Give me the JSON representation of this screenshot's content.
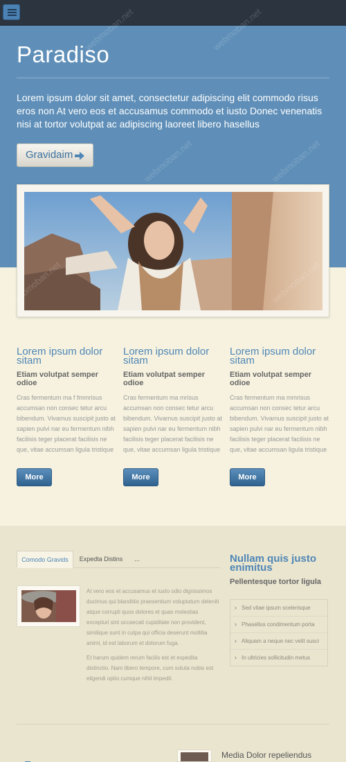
{
  "header": {
    "menu_icon": "hamburger-menu-icon"
  },
  "hero": {
    "title": "Paradiso",
    "text": "Lorem ipsum dolor sit amet, consectetur adipiscing elit commodo risus eros non At vero eos et accusamus commodo et iusto Donec venenatis nisi at tortor volutpat ac adipiscing laoreet libero hasellus",
    "button_label": "Gravidaim",
    "button_icon": "arrow-right-icon"
  },
  "features": [
    {
      "title": "Lorem ipsum dolor sitam",
      "subtitle": "Etiam volutpat semper odioe",
      "text": "Cras fermentum ma f fmmrisus accumsan non consec tetur arcu bibendum. Vivamus suscipit justo at sapien pulvi nar eu fermentum nibh facilisis teger placerat facilisis ne que, vitae accumsan ligula tristique",
      "button_label": "More"
    },
    {
      "title": "Lorem ipsum dolor sitam",
      "subtitle": "Etiam volutpat semper odioe",
      "text": "Cras fermentum ma mrisus accumsan non consec tetur arcu bibendum. Vivamus suscipit justo at sapien pulvi nar eu fermentum nibh facilisis teger placerat facilisis ne que, vitae accumsan ligula tristique",
      "button_label": "More"
    },
    {
      "title": "Lorem ipsum dolor sitam",
      "subtitle": "Etiam volutpat semper odioe",
      "text": "Cras fermentum ma mmrisus accumsan non consec tetur arcu bibendum. Vivamus suscipit justo at sapien pulvi nar eu fermentum nibh facilisis teger placerat facilisis ne que, vitae accumsan ligula tristique",
      "button_label": "More"
    }
  ],
  "tabs": {
    "items": [
      {
        "label": "Comodo Gravids"
      },
      {
        "label": "Expedta Distins"
      },
      {
        "label": "..."
      }
    ],
    "content_p1": "At vero eos et accusamus et iusto odio dignissimos ducimus qui blanditiis praesentium voluptatum deleniti atque corrupti quos dolores et quas molestias excepturi sint occaecati cupiditate non provident, similique sunt in culpa qui officia deserunt mollitia animi, id est laborum et dolorum fuga.",
    "content_p2": "Et harum quidem rerum facilis est et expedita distinctio. Nam libero tempore, cum soluta nobis est eligendi optio cumque nihil impedit."
  },
  "sidebar": {
    "title": "Nullam quis justo enimitus",
    "subtitle": "Pellentesque tortor ligula",
    "items": [
      {
        "label": "Sed vitae ipsum scelerisque"
      },
      {
        "label": "Phasellus condimentum porta"
      },
      {
        "label": "Aliquam a neque nec velit susci"
      },
      {
        "label": "In ultricies sollicitudin metus"
      }
    ]
  },
  "bottom": {
    "media_title": "Media Dolor repeliendus"
  },
  "watermark": "webmoban.net",
  "colors": {
    "topbar": "#2c3440",
    "hero": "#5f8fb8",
    "accent": "#4f86b6",
    "cream": "#f6f2df",
    "beige": "#e9e5cf"
  }
}
